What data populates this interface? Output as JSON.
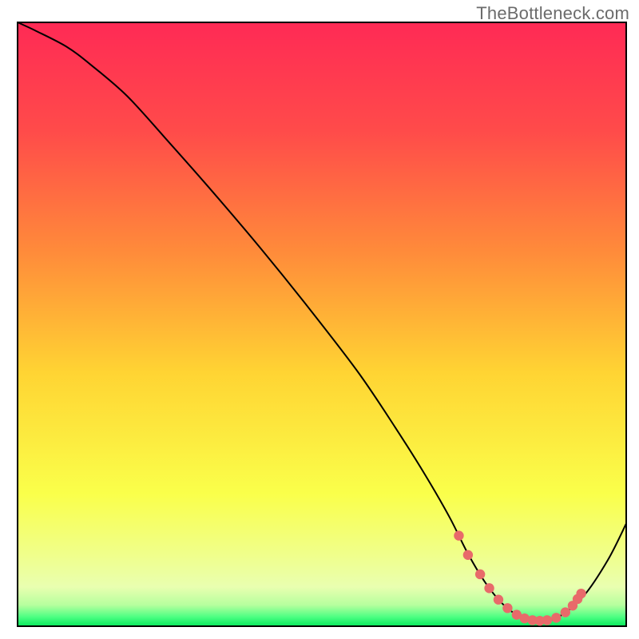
{
  "watermark": "TheBottleneck.com",
  "chart_data": {
    "type": "line",
    "title": "",
    "xlabel": "",
    "ylabel": "",
    "xlim": [
      0,
      100
    ],
    "ylim": [
      0,
      100
    ],
    "background_gradient_stops": [
      {
        "offset": 0.0,
        "color": "#ff2a55"
      },
      {
        "offset": 0.18,
        "color": "#ff4b4a"
      },
      {
        "offset": 0.38,
        "color": "#ff8b3a"
      },
      {
        "offset": 0.58,
        "color": "#ffd433"
      },
      {
        "offset": 0.78,
        "color": "#faff4a"
      },
      {
        "offset": 0.88,
        "color": "#f0ff8a"
      },
      {
        "offset": 0.935,
        "color": "#e9ffb0"
      },
      {
        "offset": 0.965,
        "color": "#b6ff9e"
      },
      {
        "offset": 0.985,
        "color": "#4bff82"
      },
      {
        "offset": 1.0,
        "color": "#08e85b"
      }
    ],
    "series": [
      {
        "name": "bottleneck-curve",
        "color": "#000000",
        "stroke_width": 2,
        "x": [
          0,
          3,
          8,
          12,
          18,
          25,
          32,
          40,
          48,
          56,
          62,
          67,
          71,
          74,
          77,
          80,
          83,
          86,
          89,
          93,
          97,
          100
        ],
        "y": [
          100,
          98.6,
          96.0,
          93.0,
          87.8,
          80.0,
          72.0,
          62.5,
          52.5,
          42.0,
          33.0,
          25.0,
          18.0,
          12.0,
          7.0,
          3.4,
          1.4,
          0.8,
          1.6,
          5.0,
          11.0,
          17.0
        ]
      }
    ],
    "highlight_points": {
      "name": "optimal-range-markers",
      "color": "#e86a6a",
      "radius": 6.2,
      "x": [
        72.5,
        74.0,
        76.0,
        77.5,
        79.0,
        80.5,
        82.0,
        83.3,
        84.6,
        85.8,
        87.0,
        88.5,
        90.0,
        91.2,
        92.0,
        92.6
      ],
      "y": [
        15.0,
        11.8,
        8.6,
        6.3,
        4.4,
        3.0,
        1.9,
        1.3,
        1.0,
        0.9,
        1.0,
        1.4,
        2.3,
        3.4,
        4.5,
        5.4
      ]
    }
  }
}
